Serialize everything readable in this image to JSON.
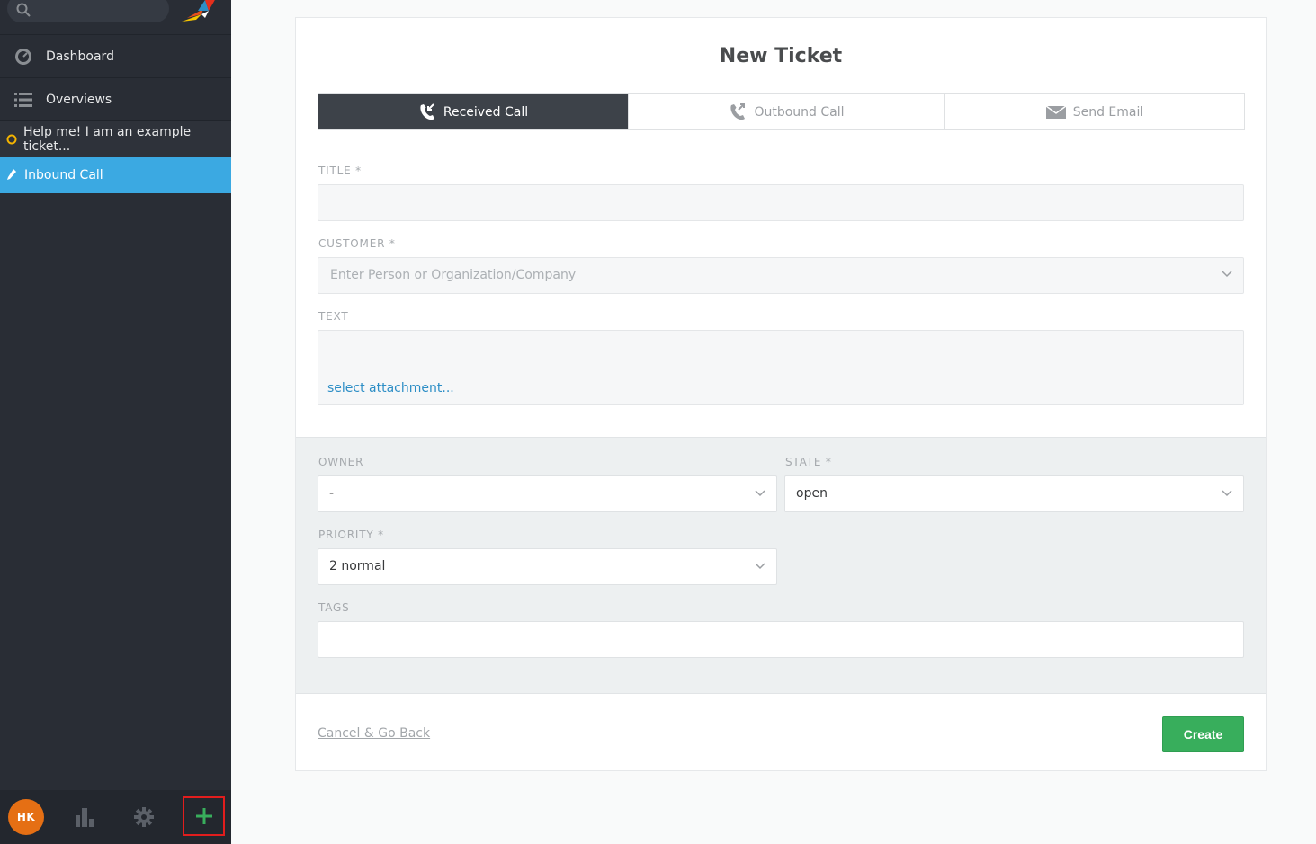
{
  "sidebar": {
    "nav": [
      {
        "label": "Dashboard",
        "icon": "dashboard-icon"
      },
      {
        "label": "Overviews",
        "icon": "list-icon"
      }
    ],
    "open_tabs": [
      {
        "label": "Help me! I am an example ticket...",
        "icon": "ticket-status-icon"
      },
      {
        "label": "Inbound Call",
        "icon": "pencil-icon"
      }
    ],
    "user_initials": "HK"
  },
  "form": {
    "title": "New Ticket",
    "tabs": [
      {
        "label": "Received Call",
        "icon": "received-call-icon",
        "active": true
      },
      {
        "label": "Outbound Call",
        "icon": "outbound-call-icon",
        "active": false
      },
      {
        "label": "Send Email",
        "icon": "email-icon",
        "active": false
      }
    ],
    "title_label": "TITLE *",
    "title_value": "",
    "customer_label": "CUSTOMER *",
    "customer_placeholder": "Enter Person or Organization/Company",
    "text_label": "TEXT",
    "attachment_link": "select attachment...",
    "owner_label": "OWNER",
    "owner_value": "-",
    "state_label": "STATE *",
    "state_value": "open",
    "priority_label": "PRIORITY *",
    "priority_value": "2 normal",
    "tags_label": "TAGS",
    "tags_value": "",
    "cancel_label": "Cancel & Go Back",
    "create_label": "Create"
  },
  "colors": {
    "sidebar_bg": "#292d35",
    "active_tab": "#3ba9e2",
    "create_button": "#38ae5c",
    "avatar": "#e56f14",
    "highlight_box": "#e11d1d"
  }
}
